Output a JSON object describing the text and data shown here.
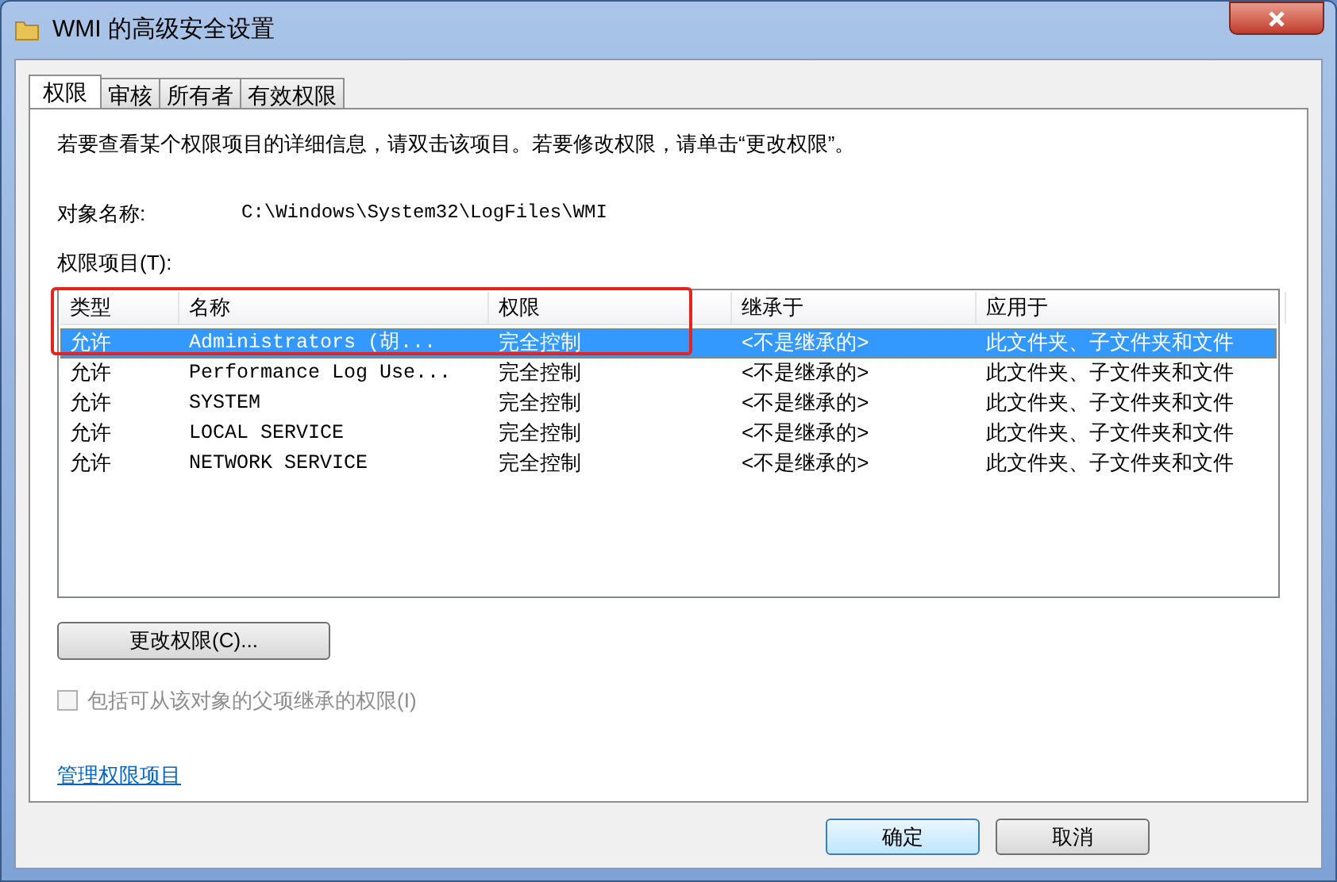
{
  "window": {
    "title": "WMI 的高级安全设置"
  },
  "tabs": [
    {
      "label": "权限",
      "selected": true
    },
    {
      "label": "审核",
      "selected": false
    },
    {
      "label": "所有者",
      "selected": false
    },
    {
      "label": "有效权限",
      "selected": false
    }
  ],
  "instructions": "若要查看某个权限项目的详细信息，请双击该项目。若要修改权限，请单击“更改权限”。",
  "object_name": {
    "label": "对象名称:",
    "value": "C:\\Windows\\System32\\LogFiles\\WMI"
  },
  "entries_label": "权限项目(T):",
  "table": {
    "columns": [
      "类型",
      "名称",
      "权限",
      "继承于",
      "应用于"
    ],
    "rows": [
      {
        "cells": [
          "允许",
          "Administrators (胡...",
          "完全控制",
          "<不是继承的>",
          "此文件夹、子文件夹和文件"
        ],
        "selected": true
      },
      {
        "cells": [
          "允许",
          "Performance Log Use...",
          "完全控制",
          "<不是继承的>",
          "此文件夹、子文件夹和文件"
        ],
        "selected": false
      },
      {
        "cells": [
          "允许",
          "SYSTEM",
          "完全控制",
          "<不是继承的>",
          "此文件夹、子文件夹和文件"
        ],
        "selected": false
      },
      {
        "cells": [
          "允许",
          "LOCAL SERVICE",
          "完全控制",
          "<不是继承的>",
          "此文件夹、子文件夹和文件"
        ],
        "selected": false
      },
      {
        "cells": [
          "允许",
          "NETWORK SERVICE",
          "完全控制",
          "<不是继承的>",
          "此文件夹、子文件夹和文件"
        ],
        "selected": false
      }
    ]
  },
  "change_button": "更改权限(C)...",
  "inherit_checkbox": {
    "label": "包括可从该对象的父项继承的权限(I)",
    "checked": false,
    "disabled": true
  },
  "manage_link": "管理权限项目",
  "buttons": [
    "确定",
    "取消"
  ]
}
